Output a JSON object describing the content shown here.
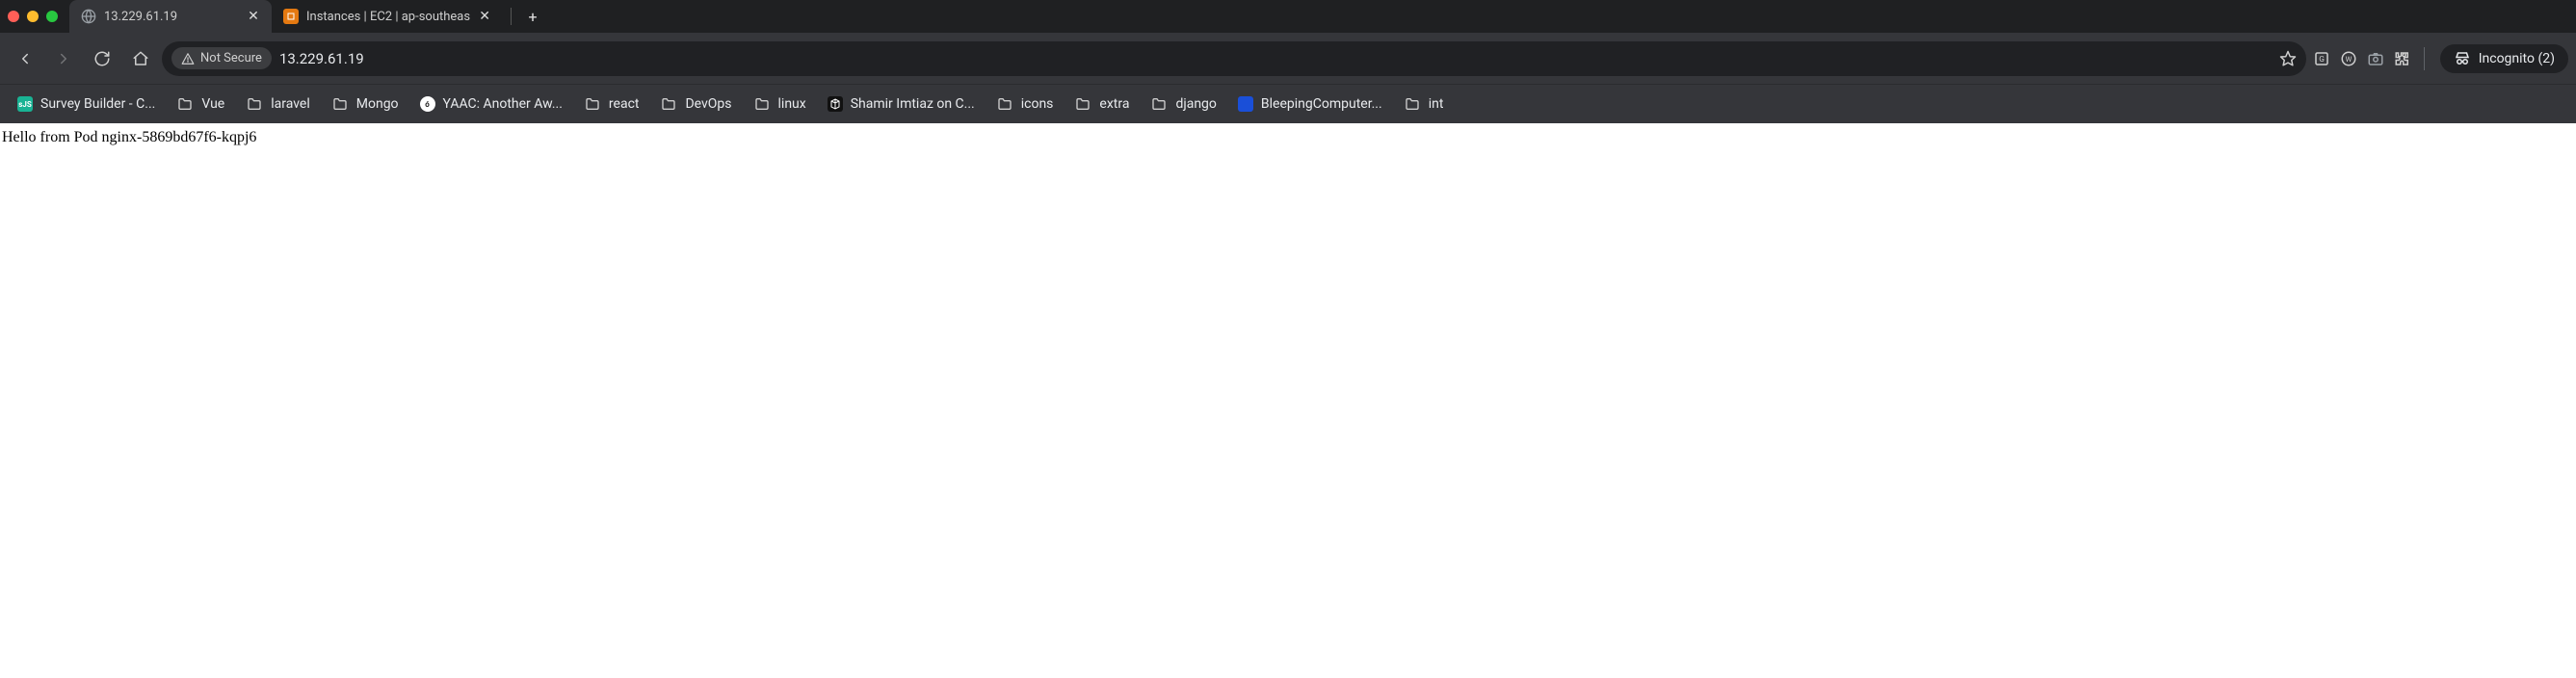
{
  "tabs": {
    "active": {
      "title": "13.229.61.19"
    },
    "other": {
      "title": "Instances | EC2 | ap-southeas"
    }
  },
  "toolbar": {
    "not_secure": "Not Secure",
    "url": "13.229.61.19",
    "incognito": "Incognito (2)"
  },
  "bookmarks": [
    {
      "icon": "sjs",
      "label": "Survey Builder - C..."
    },
    {
      "icon": "folder",
      "label": "Vue"
    },
    {
      "icon": "folder",
      "label": "laravel"
    },
    {
      "icon": "folder",
      "label": "Mongo"
    },
    {
      "icon": "yaac",
      "label": "YAAC: Another Aw..."
    },
    {
      "icon": "folder",
      "label": "react"
    },
    {
      "icon": "folder",
      "label": "DevOps"
    },
    {
      "icon": "folder",
      "label": "linux"
    },
    {
      "icon": "csb",
      "label": "Shamir Imtiaz on C..."
    },
    {
      "icon": "folder",
      "label": "icons"
    },
    {
      "icon": "folder",
      "label": "extra"
    },
    {
      "icon": "folder",
      "label": "django"
    },
    {
      "icon": "bc",
      "label": "BleepingComputer..."
    },
    {
      "icon": "folder",
      "label": "int"
    }
  ],
  "content": {
    "body_text": "Hello from Pod nginx-5869bd67f6-kqpj6"
  }
}
